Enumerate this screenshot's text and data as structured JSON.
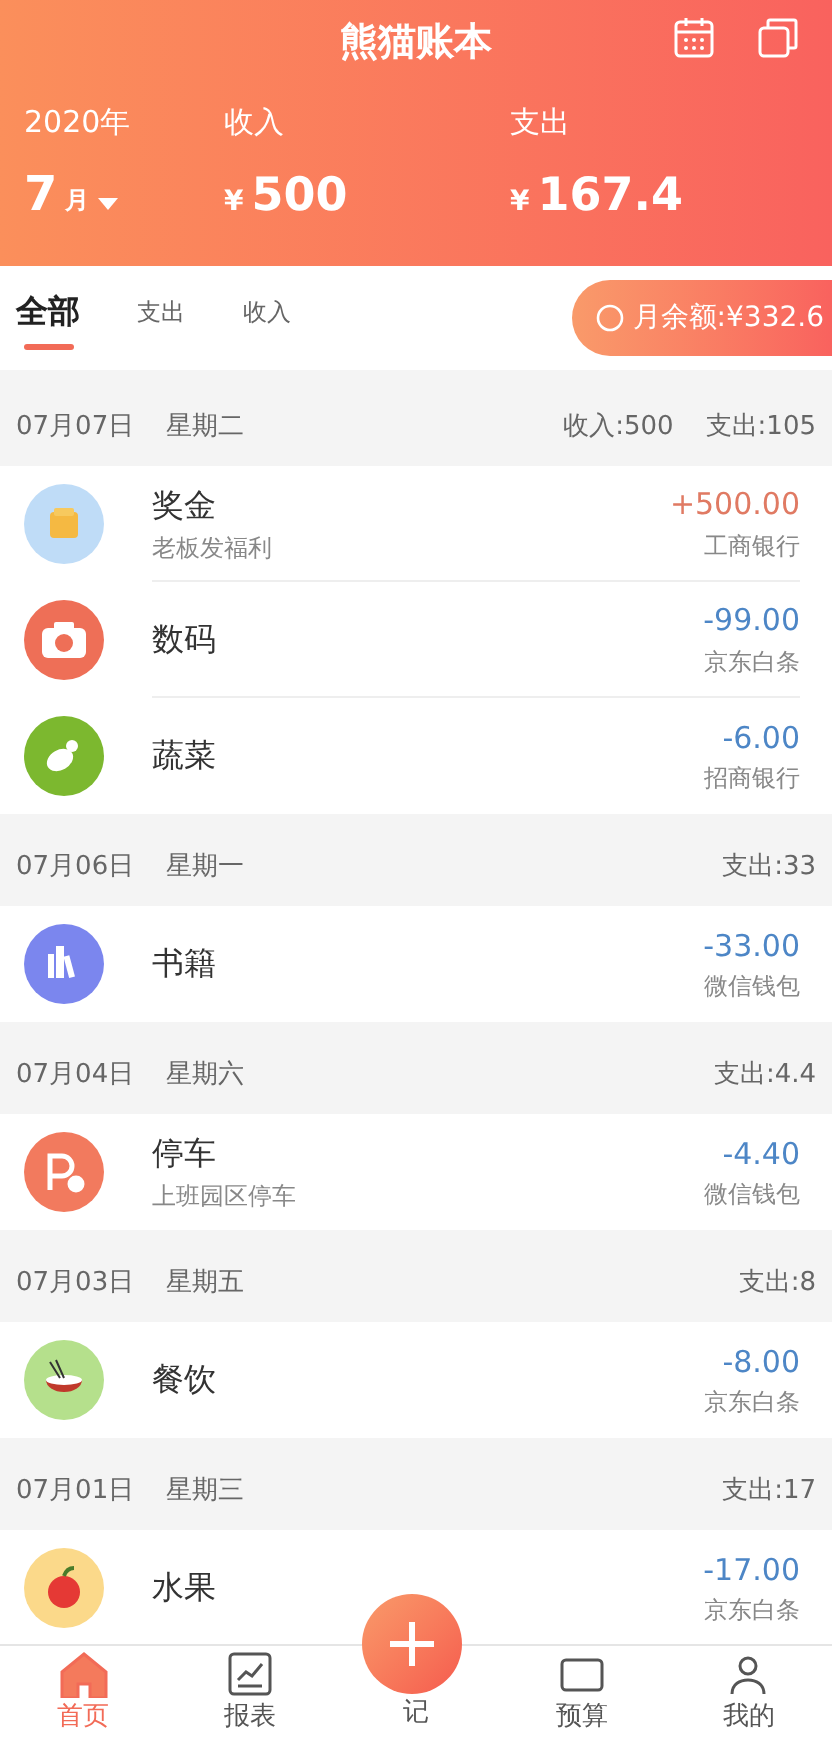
{
  "app_title": "熊猫账本",
  "summary": {
    "year": "2020年",
    "month": "7",
    "month_unit": "月",
    "income_label": "收入",
    "income": "500",
    "expense_label": "支出",
    "expense": "167.4",
    "currency": "¥"
  },
  "tabs": [
    {
      "label": "全部",
      "selected": true
    },
    {
      "label": "支出",
      "selected": false
    },
    {
      "label": "收入",
      "selected": false
    }
  ],
  "balance": {
    "label": "月余额:",
    "value": "¥332.6"
  },
  "days": [
    {
      "date": "07月07日",
      "weekday": "星期二",
      "totals": [
        "收入:500",
        "支出:105"
      ],
      "entries": [
        {
          "kind": "bonus",
          "color": "#bfdcf7",
          "category": "奖金",
          "note": "老板发福利",
          "amount": "+500.00",
          "income": true,
          "account": "工商银行"
        },
        {
          "kind": "camera",
          "color": "#ee6f57",
          "category": "数码",
          "amount": "-99.00",
          "income": false,
          "account": "京东白条"
        },
        {
          "kind": "vegetable",
          "color": "#7cb82f",
          "category": "蔬菜",
          "amount": "-6.00",
          "income": false,
          "account": "招商银行"
        }
      ]
    },
    {
      "date": "07月06日",
      "weekday": "星期一",
      "totals": [
        "支出:33"
      ],
      "entries": [
        {
          "kind": "books",
          "color": "#7b86ee",
          "category": "书籍",
          "amount": "-33.00",
          "income": false,
          "account": "微信钱包"
        }
      ]
    },
    {
      "date": "07月04日",
      "weekday": "星期六",
      "totals": [
        "支出:4.4"
      ],
      "entries": [
        {
          "kind": "parking",
          "color": "#f27a5e",
          "category": "停车",
          "note": "上班园区停车",
          "amount": "-4.40",
          "income": false,
          "account": "微信钱包"
        }
      ]
    },
    {
      "date": "07月03日",
      "weekday": "星期五",
      "totals": [
        "支出:8"
      ],
      "entries": [
        {
          "kind": "dining",
          "color": "#b5e08c",
          "category": "餐饮",
          "amount": "-8.00",
          "income": false,
          "account": "京东白条"
        }
      ]
    },
    {
      "date": "07月01日",
      "weekday": "星期三",
      "totals": [
        "支出:17"
      ],
      "entries": [
        {
          "kind": "fruit",
          "color": "#fbd98a",
          "category": "水果",
          "amount": "-17.00",
          "income": false,
          "account": "京东白条"
        }
      ]
    }
  ],
  "nav": [
    {
      "kind": "home",
      "label": "首页",
      "selected": true
    },
    {
      "kind": "report",
      "label": "报表",
      "selected": false
    },
    {
      "kind": "add",
      "label": "记",
      "selected": false
    },
    {
      "kind": "budget",
      "label": "预算",
      "selected": false
    },
    {
      "kind": "mine",
      "label": "我的",
      "selected": false
    }
  ]
}
